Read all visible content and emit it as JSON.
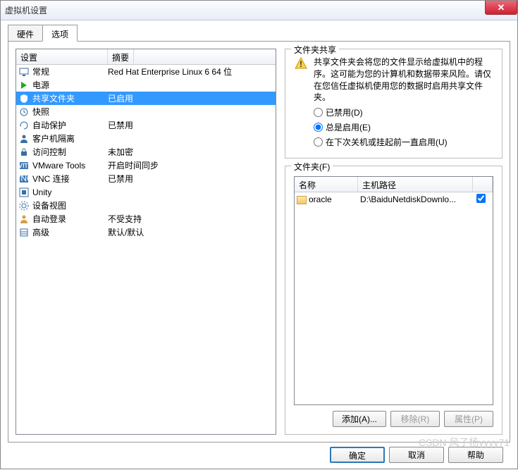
{
  "title": "虚拟机设置",
  "tabs": {
    "hardware": "硬件",
    "options": "选项"
  },
  "listhead": {
    "setting": "设置",
    "summary": "摘要"
  },
  "settings": [
    {
      "icon": "monitor",
      "label": "常规",
      "summary": "Red Hat Enterprise Linux 6 64 位"
    },
    {
      "icon": "power",
      "label": "电源",
      "summary": ""
    },
    {
      "icon": "shield",
      "label": "共享文件夹",
      "summary": "已启用",
      "selected": true
    },
    {
      "icon": "clock",
      "label": "快照",
      "summary": ""
    },
    {
      "icon": "cycle",
      "label": "自动保护",
      "summary": "已禁用"
    },
    {
      "icon": "person",
      "label": "客户机隔离",
      "summary": ""
    },
    {
      "icon": "lock",
      "label": "访问控制",
      "summary": "未加密"
    },
    {
      "icon": "vm",
      "label": "VMware Tools",
      "summary": "开启时间同步"
    },
    {
      "icon": "vnc",
      "label": "VNC 连接",
      "summary": "已禁用"
    },
    {
      "icon": "unity",
      "label": "Unity",
      "summary": ""
    },
    {
      "icon": "gear",
      "label": "设备视图",
      "summary": ""
    },
    {
      "icon": "user",
      "label": "自动登录",
      "summary": "不受支持"
    },
    {
      "icon": "wrench",
      "label": "高级",
      "summary": "默认/默认"
    }
  ],
  "share": {
    "group_title": "文件夹共享",
    "warning": "共享文件夹会将您的文件显示给虚拟机中的程序。这可能为您的计算机和数据带来风险。请仅在您信任虚拟机使用您的数据时启用共享文件夹。",
    "opt_disabled": "已禁用(D)",
    "opt_always": "总是启用(E)",
    "opt_until": "在下次关机或挂起前一直启用(U)",
    "selected": "always"
  },
  "folders": {
    "group_title": "文件夹(F)",
    "head": {
      "name": "名称",
      "path": "主机路径"
    },
    "rows": [
      {
        "name": "oracle",
        "path": "D:\\BaiduNetdiskDownlo...",
        "checked": true
      }
    ],
    "add": "添加(A)...",
    "remove": "移除(R)",
    "props": "属性(P)"
  },
  "footer": {
    "ok": "确定",
    "cancel": "取消",
    "help": "帮助"
  },
  "watermark": "CSDN 风子杨yyyy71"
}
